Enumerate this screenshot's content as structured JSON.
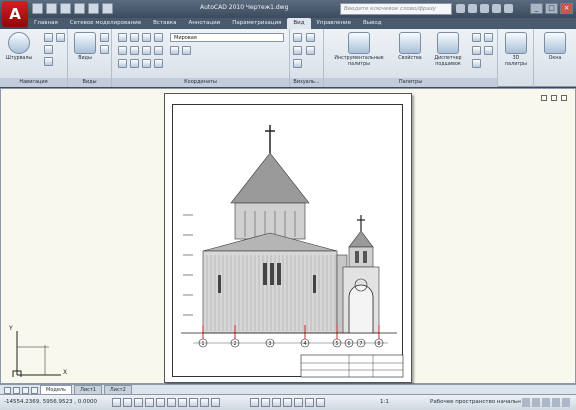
{
  "window": {
    "title": "AutoCAD 2010    Чертеж1.dwg",
    "search_placeholder": "Введите ключевое слово/фразу",
    "logo_letter": "A"
  },
  "menu_tabs": [
    {
      "label": "Главная"
    },
    {
      "label": "Сетевое моделирование"
    },
    {
      "label": "Вставка"
    },
    {
      "label": "Аннотации"
    },
    {
      "label": "Параметризация"
    },
    {
      "label": "Вид",
      "active": true
    },
    {
      "label": "Управление"
    },
    {
      "label": "Вывод"
    }
  ],
  "ribbon": {
    "navigation": {
      "title": "Навигация",
      "button": "Штурвалы"
    },
    "views": {
      "title": "Виды",
      "button": "Виды"
    },
    "coordinates": {
      "title": "Координаты",
      "combo": "Мировая"
    },
    "visual_styles": {
      "title": "Визуаль..."
    },
    "palettes": {
      "title": "Палитры",
      "tool_palettes": "Инструментальные палитры",
      "properties": "Свойства",
      "sheet_set": "Диспетчер подшивок"
    },
    "palettes_3d": {
      "button": "3D палитры"
    },
    "windows": {
      "button": "Окна"
    }
  },
  "layout_tabs": [
    {
      "label": "Модель",
      "active": true
    },
    {
      "label": "Лист1"
    },
    {
      "label": "Лист2"
    }
  ],
  "ucs": {
    "x": "X",
    "y": "Y"
  },
  "status": {
    "coordinates": "-14554.2369, 5956.9523 , 0.0000",
    "scale": "1:1",
    "workspace": "Рабочее пространство начальн"
  },
  "drawing": {
    "grid_axes": [
      "1",
      "2",
      "3",
      "4",
      "5",
      "6",
      "7",
      "8"
    ]
  },
  "colors": {
    "accent": "#d42020",
    "ribbon": "#dfe6ee",
    "paper": "#ffffff"
  }
}
